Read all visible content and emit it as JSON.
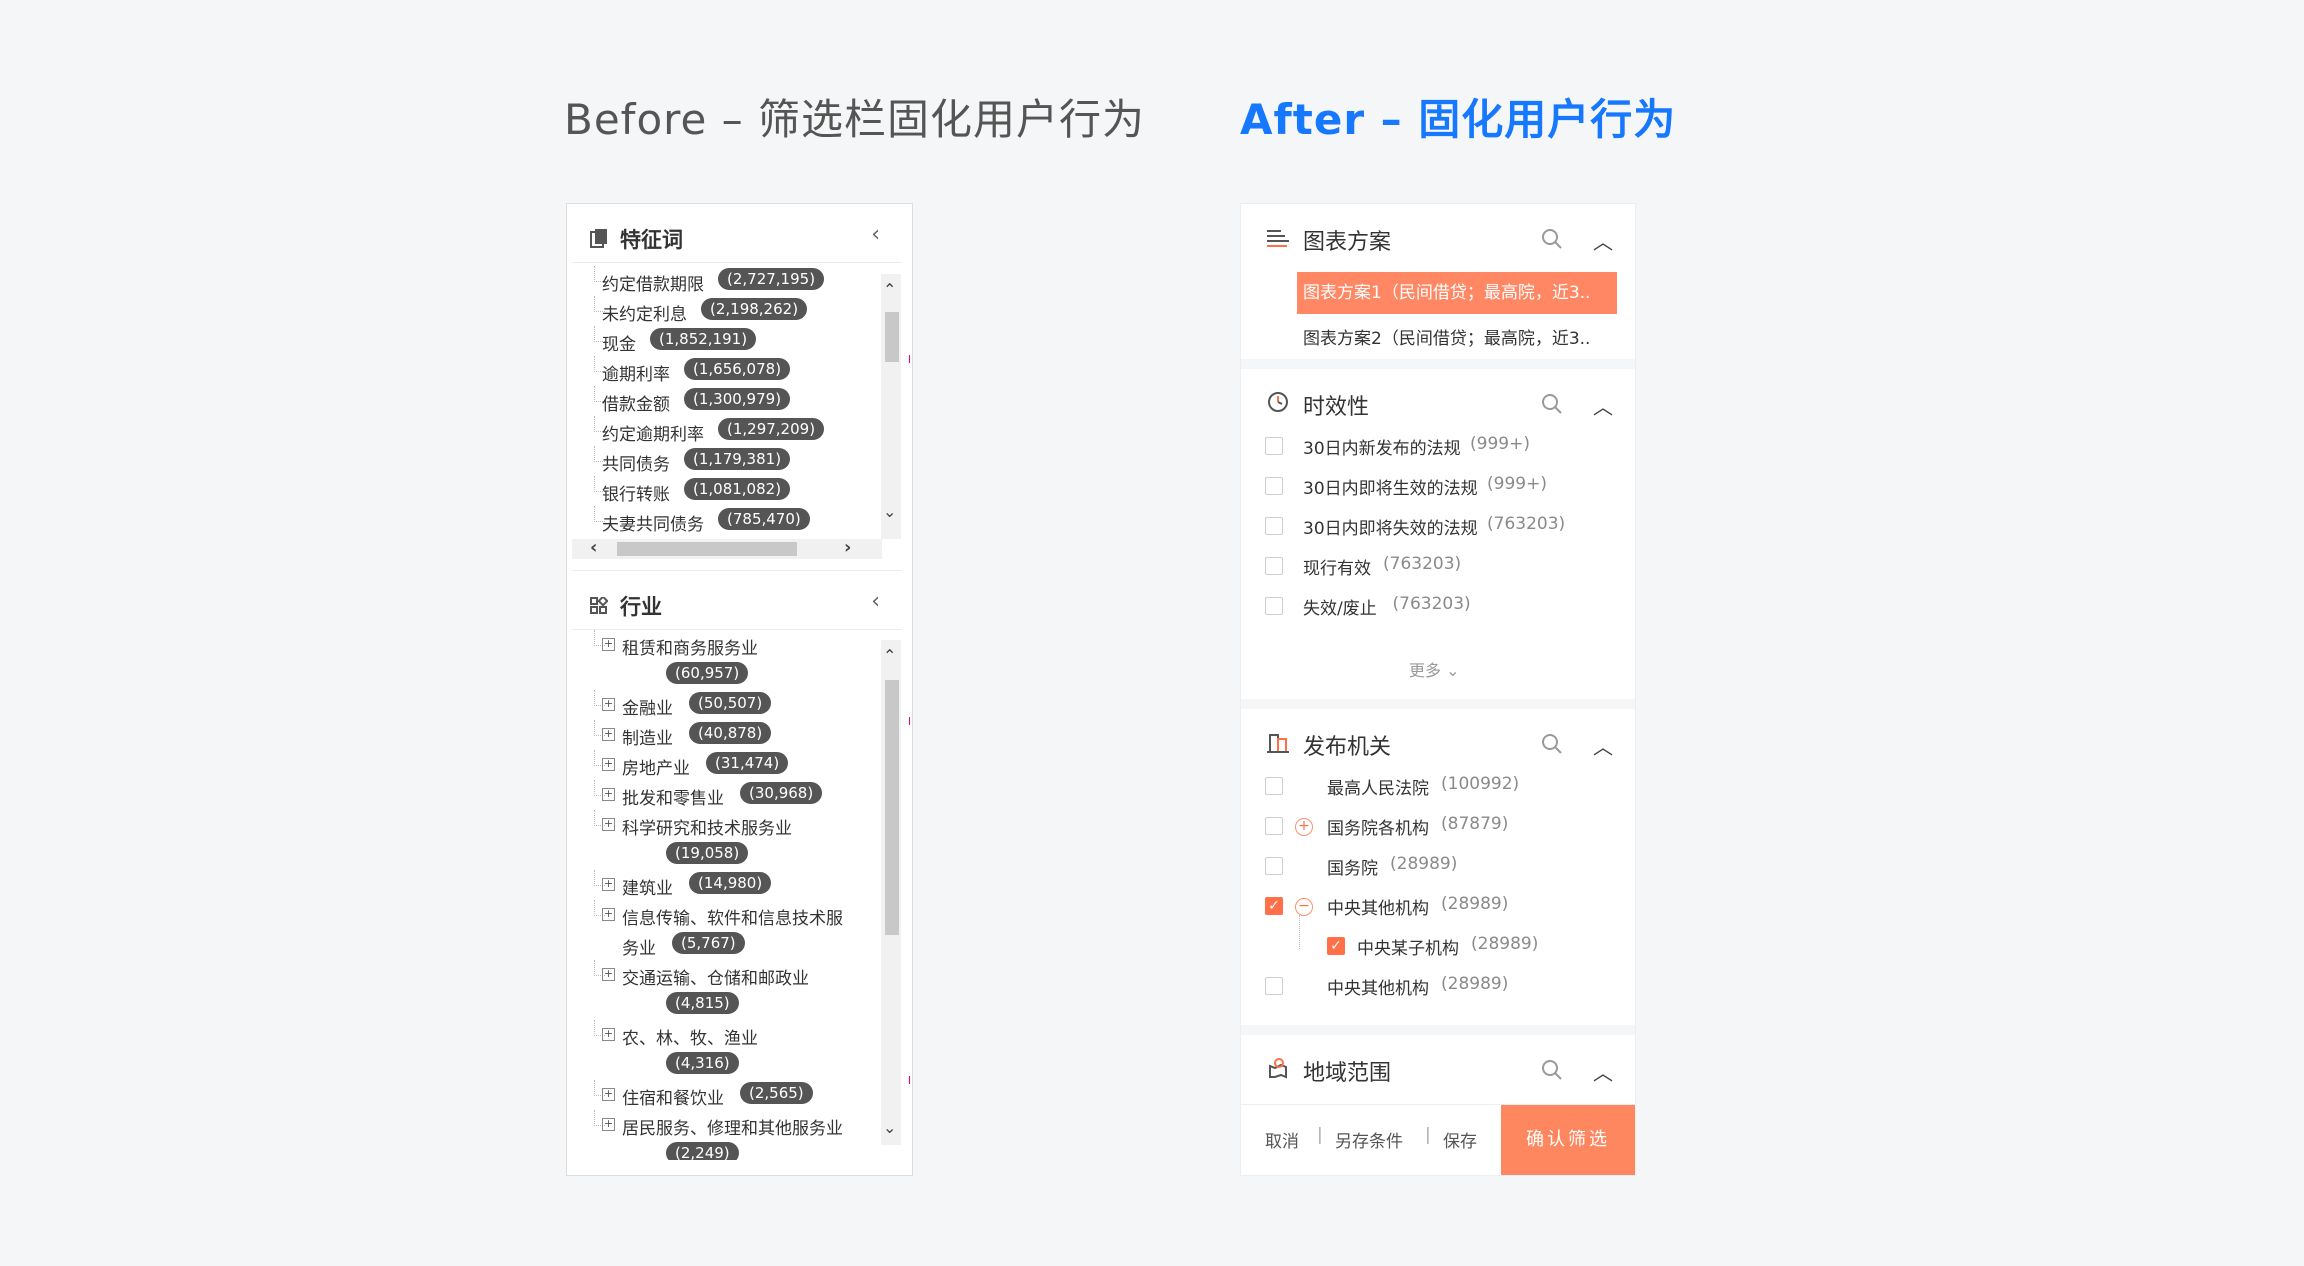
{
  "headings": {
    "before": "Before – 筛选栏固化用户行为",
    "after": "After – 固化用户行为"
  },
  "before": {
    "keywords": {
      "title": "特征词",
      "items": [
        {
          "label": "约定借款期限",
          "count": "(2,727,195)"
        },
        {
          "label": "未约定利息",
          "count": "(2,198,262)"
        },
        {
          "label": "现金",
          "count": "(1,852,191)"
        },
        {
          "label": "逾期利率",
          "count": "(1,656,078)"
        },
        {
          "label": "借款金额",
          "count": "(1,300,979)"
        },
        {
          "label": "约定逾期利率",
          "count": "(1,297,209)"
        },
        {
          "label": "共同债务",
          "count": "(1,179,381)"
        },
        {
          "label": "银行转账",
          "count": "(1,081,082)"
        },
        {
          "label": "夫妻共同债务",
          "count": "(785,470)"
        }
      ]
    },
    "industry": {
      "title": "行业",
      "items": [
        {
          "label": "租赁和商务服务业",
          "count": "(60,957)",
          "wrap": true
        },
        {
          "label": "金融业",
          "count": "(50,507)"
        },
        {
          "label": "制造业",
          "count": "(40,878)"
        },
        {
          "label": "房地产业",
          "count": "(31,474)"
        },
        {
          "label": "批发和零售业",
          "count": "(30,968)"
        },
        {
          "label": "科学研究和技术服务业",
          "count": "(19,058)",
          "wrap": true
        },
        {
          "label": "建筑业",
          "count": "(14,980)"
        },
        {
          "label": "信息传输、软件和信息技术服",
          "label2": "务业",
          "count": "(5,767)"
        },
        {
          "label": "交通运输、仓储和邮政业",
          "count": "(4,815)",
          "wrap": true
        },
        {
          "label": "农、林、牧、渔业",
          "count": "(4,316)",
          "wrap": true
        },
        {
          "label": "住宿和餐饮业",
          "count": "(2,565)"
        },
        {
          "label": "居民服务、修理和其他服务业",
          "count": "(2,249)",
          "wrap": true
        }
      ]
    }
  },
  "after": {
    "plans": {
      "title": "图表方案",
      "items": [
        "图表方案1（民间借贷；最高院，近3..",
        "图表方案2（民间借贷；最高院，近3.."
      ]
    },
    "timeliness": {
      "title": "时效性",
      "items": [
        {
          "label": "30日内新发布的法规",
          "count": "(999+)"
        },
        {
          "label": "30日内即将生效的法规",
          "count": "(999+)"
        },
        {
          "label": "30日内即将失效的法规",
          "count": "(763203)"
        },
        {
          "label": "现行有效",
          "count": "(763203)"
        },
        {
          "label": "失效/废止",
          "count": "(763203)"
        }
      ],
      "more": "更多"
    },
    "authority": {
      "title": "发布机关",
      "items": [
        {
          "label": "最高人民法院",
          "count": "(100992)",
          "checked": false,
          "toggle": ""
        },
        {
          "label": "国务院各机构",
          "count": "(87879)",
          "checked": false,
          "toggle": "+"
        },
        {
          "label": "国务院",
          "count": "(28989)",
          "checked": false,
          "toggle": ""
        },
        {
          "label": "中央其他机构",
          "count": "(28989)",
          "checked": true,
          "toggle": "−"
        },
        {
          "label": "中央某子机构",
          "count": "(28989)",
          "checked": true,
          "toggle": "",
          "child": true
        },
        {
          "label": "中央其他机构",
          "count": "(28989)",
          "checked": false,
          "toggle": ""
        }
      ]
    },
    "region": {
      "title": "地域范围"
    },
    "footer": {
      "cancel": "取消",
      "save_as": "另存条件",
      "save": "保存",
      "confirm": "确认筛选"
    }
  },
  "colors": {
    "accent_blue": "#1677ff",
    "accent_orange": "#ff875f",
    "pill": "#555555"
  }
}
